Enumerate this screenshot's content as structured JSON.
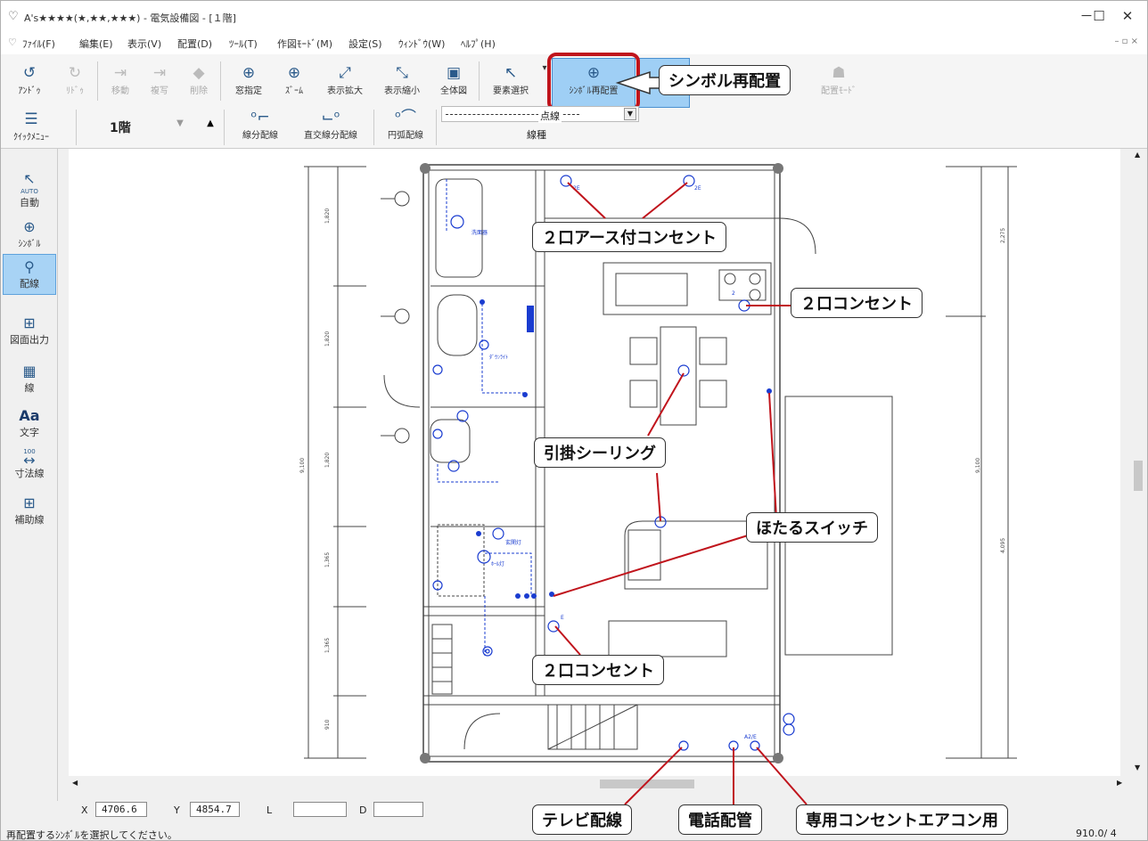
{
  "window": {
    "title": "A's★★★★(★,★★,★★★) - 電気設備図 - [１階]",
    "minimize": "－",
    "maximize": "☐",
    "close": "✕"
  },
  "menu": [
    {
      "label": "ﾌｧｲﾙ(F)"
    },
    {
      "label": "編集(E)"
    },
    {
      "label": "表示(V)"
    },
    {
      "label": "配置(D)"
    },
    {
      "label": "ﾂｰﾙ(T)"
    },
    {
      "label": "作図ﾓｰﾄﾞ(M)"
    },
    {
      "label": "設定(S)"
    },
    {
      "label": "ｳｨﾝﾄﾞｳ(W)"
    },
    {
      "label": "ﾍﾙﾌﾟ(H)"
    }
  ],
  "toolbar": {
    "row1": [
      {
        "label": "ｱﾝﾄﾞｩ",
        "icon": "undo-icon",
        "glyph": "↺",
        "dim": false
      },
      {
        "label": "ﾘﾄﾞｩ",
        "icon": "redo-icon",
        "glyph": "↻",
        "dim": true
      },
      {
        "label": "移動",
        "icon": "move-icon",
        "glyph": "⇥",
        "dim": true
      },
      {
        "label": "複写",
        "icon": "copy-icon",
        "glyph": "⇥",
        "dim": true
      },
      {
        "label": "削除",
        "icon": "delete-icon",
        "glyph": "◆",
        "dim": true
      },
      {
        "label": "窓指定",
        "icon": "window-zoom-icon",
        "glyph": "⊕",
        "dim": false
      },
      {
        "label": "ｽﾞｰﾑ",
        "icon": "zoom-icon",
        "glyph": "⊕",
        "dim": false
      },
      {
        "label": "表示拡大",
        "icon": "zoom-in-icon",
        "glyph": "⤢",
        "dim": false
      },
      {
        "label": "表示縮小",
        "icon": "zoom-out-icon",
        "glyph": "⤡",
        "dim": false
      },
      {
        "label": "全体図",
        "icon": "fit-all-icon",
        "glyph": "▣",
        "dim": false
      },
      {
        "label": "要素選択",
        "icon": "select-icon",
        "glyph": "↖",
        "dim": false
      },
      {
        "label": "ｼﾝﾎﾞﾙ再配置",
        "icon": "symbol-reposition-icon",
        "glyph": "⊕",
        "dim": false
      },
      {
        "label": "配置ﾓｰﾄﾞ",
        "icon": "place-mode-icon",
        "glyph": "☗",
        "dim": true
      }
    ],
    "row2": {
      "quick_menu": "ｸｲｯｸﾒﾆｭｰ",
      "floor": "1階",
      "down": "▼",
      "up": "▲",
      "segment_wiring": "線分配線",
      "orthogonal_wiring": "直交線分配線",
      "arc_wiring": "円弧配線",
      "line_style_value": "点線",
      "line_style_caption": "線種"
    }
  },
  "sidebar": [
    {
      "label": "自動",
      "icon": "auto-cursor-icon",
      "glyph": "↖",
      "sub": "AUTO"
    },
    {
      "label": "ｼﾝﾎﾞﾙ",
      "icon": "symbol-icon",
      "glyph": "⊕",
      "sub": ""
    },
    {
      "label": "配線",
      "icon": "wiring-icon",
      "glyph": "⚲",
      "sub": ""
    },
    {
      "label": "図面出力",
      "icon": "drawing-output-icon",
      "glyph": "⊞",
      "sub": ""
    },
    {
      "label": "線",
      "icon": "line-icon",
      "glyph": "▦",
      "sub": ""
    },
    {
      "label": "文字",
      "icon": "text-icon",
      "glyph": "Aa",
      "sub": ""
    },
    {
      "label": "寸法線",
      "icon": "dimension-icon",
      "glyph": "↔",
      "sub": "100"
    },
    {
      "label": "補助線",
      "icon": "guide-line-icon",
      "glyph": "⊞",
      "sub": ""
    }
  ],
  "callouts": {
    "reposition": "シンボル再配置",
    "earth_outlet": "２口アース付コンセント",
    "outlet_kitchen": "２口コンセント",
    "ceiling": "引掛シーリング",
    "firefly_switch": "ほたるスイッチ",
    "outlet_lower": "２口コンセント",
    "tv": "テレビ配線",
    "phone": "電話配管",
    "aircon": "専用コンセントエアコン用"
  },
  "drawing_labels": {
    "dim_left": [
      "1,820",
      "1,820",
      "1,820",
      "1,365",
      "1,365",
      "910",
      "9,100"
    ],
    "dim_right": [
      "2,275",
      "9,100",
      "4,095"
    ],
    "room_tags": [
      "2E",
      "2E",
      "2",
      "洗面器",
      "ﾀﾞｳﾝﾗｲﾄ",
      "玄関灯",
      "ﾎｰﾙ灯",
      "E",
      "A2/E"
    ]
  },
  "coords": {
    "x_label": "X",
    "x_value": "4706.6",
    "y_label": "Y",
    "y_value": "4854.7",
    "l_label": "L",
    "l_value": "",
    "d_label": "D",
    "d_value": ""
  },
  "status": {
    "message": "再配置するｼﾝﾎﾞﾙを選択してください。",
    "page": "910.0/ 4"
  }
}
